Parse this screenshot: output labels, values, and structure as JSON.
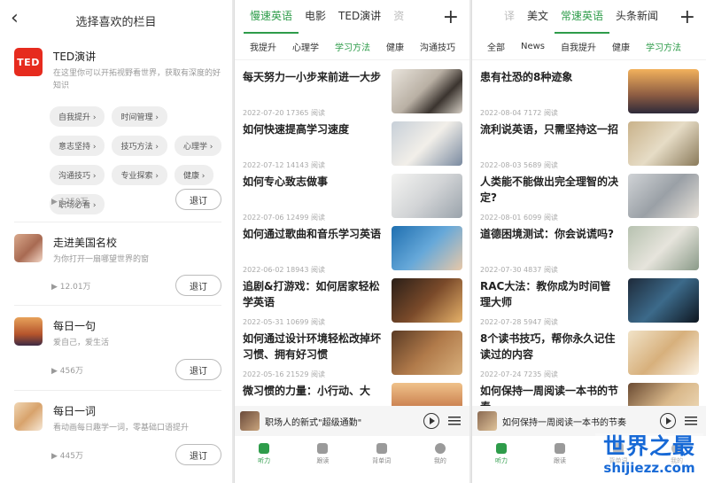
{
  "channels_page": {
    "title": "选择喜欢的栏目",
    "channels": [
      {
        "icon_text": "TED",
        "name": "TED演讲",
        "desc": "在这里你可以开拓视野看世界，获取有深度的好知识",
        "plays": "▶ 1250万",
        "button": "退订",
        "tags": [
          "自我提升 ›",
          "时间管理 ›",
          "意志坚持 ›",
          "技巧方法 ›",
          "心理学 ›",
          "沟通技巧 ›",
          "专业探索 ›",
          "健康 ›",
          "职场必看 ›"
        ]
      },
      {
        "name": "走进美国名校",
        "desc": "为你打开一扇哪望世界的窗",
        "plays": "▶ 12.01万",
        "button": "退订"
      },
      {
        "name": "每日一句",
        "desc": "爱自己，爱生活",
        "plays": "▶ 456万",
        "button": "退订"
      },
      {
        "name": "每日一词",
        "desc": "看动画每日趣学一词，零基础口语提升",
        "plays": "▶ 445万",
        "button": "退订"
      }
    ]
  },
  "feed_left": {
    "tabs": [
      "慢速英语",
      "电影",
      "TED演讲",
      "资"
    ],
    "active_tab": "慢速英语",
    "subtabs": [
      "我提升",
      "心理学",
      "学习方法",
      "健康",
      "沟通技巧"
    ],
    "active_subtab": "学习方法",
    "articles": [
      {
        "title": "每天努力一小步来前进一大步",
        "meta": "2022-07-20    17365 阅读",
        "img": "coffee"
      },
      {
        "title": "如何快速提高学习速度",
        "meta": "2022-07-12    14143 阅读",
        "img": "study"
      },
      {
        "title": "如何专心致志做事",
        "meta": "2022-07-06    12499 阅读",
        "img": "laptop"
      },
      {
        "title": "如何通过歌曲和音乐学习英语",
        "meta": "2022-06-02    18943 阅读",
        "img": "music"
      },
      {
        "title": "追剧&打游戏：如何居家轻松学英语",
        "meta": "2022-05-31    10699 阅读",
        "img": "games"
      },
      {
        "title": "如何通过设计环境轻松改掉坏习惯、拥有好习惯",
        "meta": "2022-05-16    21529 阅读",
        "img": "books"
      },
      {
        "title": "微习惯的力量：小行动、大",
        "meta": "",
        "img": "sunset"
      }
    ],
    "player_title": "职场人的新式\"超级通勤\"",
    "bottom_tabs": [
      "听力",
      "跟读",
      "背单词",
      "我的"
    ]
  },
  "feed_right": {
    "tabs": [
      "译",
      "美文",
      "常速英语",
      "头条新闻"
    ],
    "active_tab": "常速英语",
    "subtabs": [
      "全部",
      "News",
      "自我提升",
      "健康",
      "学习方法"
    ],
    "active_subtab": "学习方法",
    "articles": [
      {
        "title": "患有社恐的8种迹象",
        "meta": "2022-08-04    7172 阅读",
        "img": "sunset2"
      },
      {
        "title": "流利说英语，只需坚持这一招",
        "meta": "2022-08-03    5689 阅读",
        "img": "trumpet"
      },
      {
        "title": "人类能不能做出完全理智的决定?",
        "meta": "2022-08-01    6099 阅读",
        "img": "people"
      },
      {
        "title": "道德困境测试：你会说谎吗?",
        "meta": "2022-07-30    4837 阅读",
        "img": "hand"
      },
      {
        "title": "RAC大法：教你成为时间管理大师",
        "meta": "2022-07-28    5947 阅读",
        "img": "clock"
      },
      {
        "title": "8个读书技巧，帮你永久记住读过的内容",
        "meta": "2022-07-24    7235 阅读",
        "img": "reader"
      },
      {
        "title": "如何保持一周阅读一本书的节奏",
        "meta": "",
        "img": "book2"
      }
    ],
    "player_title": "如何保持一周阅读一本书的节奏",
    "bottom_tabs": [
      "听力",
      "跟读",
      "背单词",
      "我的"
    ]
  },
  "watermark": {
    "line1": "世界之最",
    "line2": "shijiezz.com"
  },
  "accent_color": "#2e9c4a"
}
